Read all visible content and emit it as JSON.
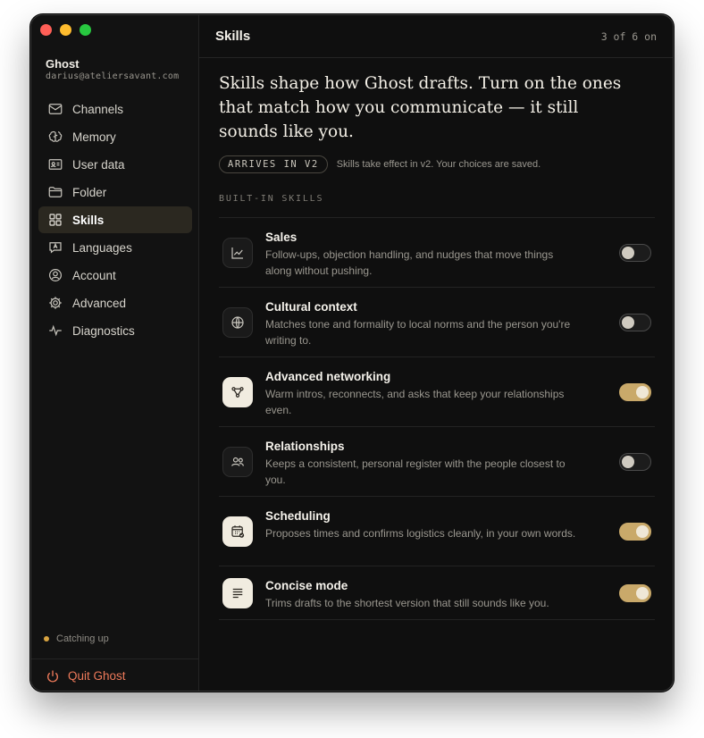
{
  "account": {
    "name": "Ghost",
    "email": "darius@ateliersavant.com"
  },
  "nav": [
    {
      "label": "Channels",
      "icon": "envelope-icon",
      "active": false
    },
    {
      "label": "Memory",
      "icon": "brain-icon",
      "active": false
    },
    {
      "label": "User data",
      "icon": "id-card-icon",
      "active": false
    },
    {
      "label": "Folder",
      "icon": "folder-icon",
      "active": false
    },
    {
      "label": "Skills",
      "icon": "grid-icon",
      "active": true
    },
    {
      "label": "Languages",
      "icon": "language-icon",
      "active": false
    },
    {
      "label": "Account",
      "icon": "user-circle-icon",
      "active": false
    },
    {
      "label": "Advanced",
      "icon": "gear-icon",
      "active": false
    },
    {
      "label": "Diagnostics",
      "icon": "pulse-icon",
      "active": false
    }
  ],
  "status": {
    "text": "Catching up",
    "color": "#d9a441"
  },
  "quit_label": "Quit Ghost",
  "topbar": {
    "title": "Skills",
    "count": "3 of 6 on"
  },
  "headline": "Skills shape how Ghost drafts. Turn on the ones that match how you communicate — it still sounds like you.",
  "badge": {
    "label": "ARRIVES IN V2",
    "note": "Skills take effect in v2. Your choices are saved."
  },
  "section_label": "BUILT-IN SKILLS",
  "skills": [
    {
      "title": "Sales",
      "desc": "Follow-ups, objection handling, and nudges that move things along without pushing.",
      "icon": "trend-chart-icon",
      "on": false
    },
    {
      "title": "Cultural context",
      "desc": "Matches tone and formality to local norms and the person you're writing to.",
      "icon": "globe-icon",
      "on": false
    },
    {
      "title": "Advanced networking",
      "desc": "Warm intros, reconnects, and asks that keep your relationships even.",
      "icon": "network-icon",
      "on": true
    },
    {
      "title": "Relationships",
      "desc": "Keeps a consistent, personal register with the people closest to you.",
      "icon": "people-icon",
      "on": false
    },
    {
      "title": "Scheduling",
      "desc": "Proposes times and confirms logistics cleanly, in your own words.",
      "icon": "calendar-check-icon",
      "on": true
    },
    {
      "title": "Concise mode",
      "desc": "Trims drafts to the shortest version that still sounds like you.",
      "icon": "text-lines-icon",
      "on": true
    }
  ],
  "colors": {
    "accent": "#c9a96a",
    "quit": "#ef7a5a",
    "background": "#0f0f0f"
  }
}
